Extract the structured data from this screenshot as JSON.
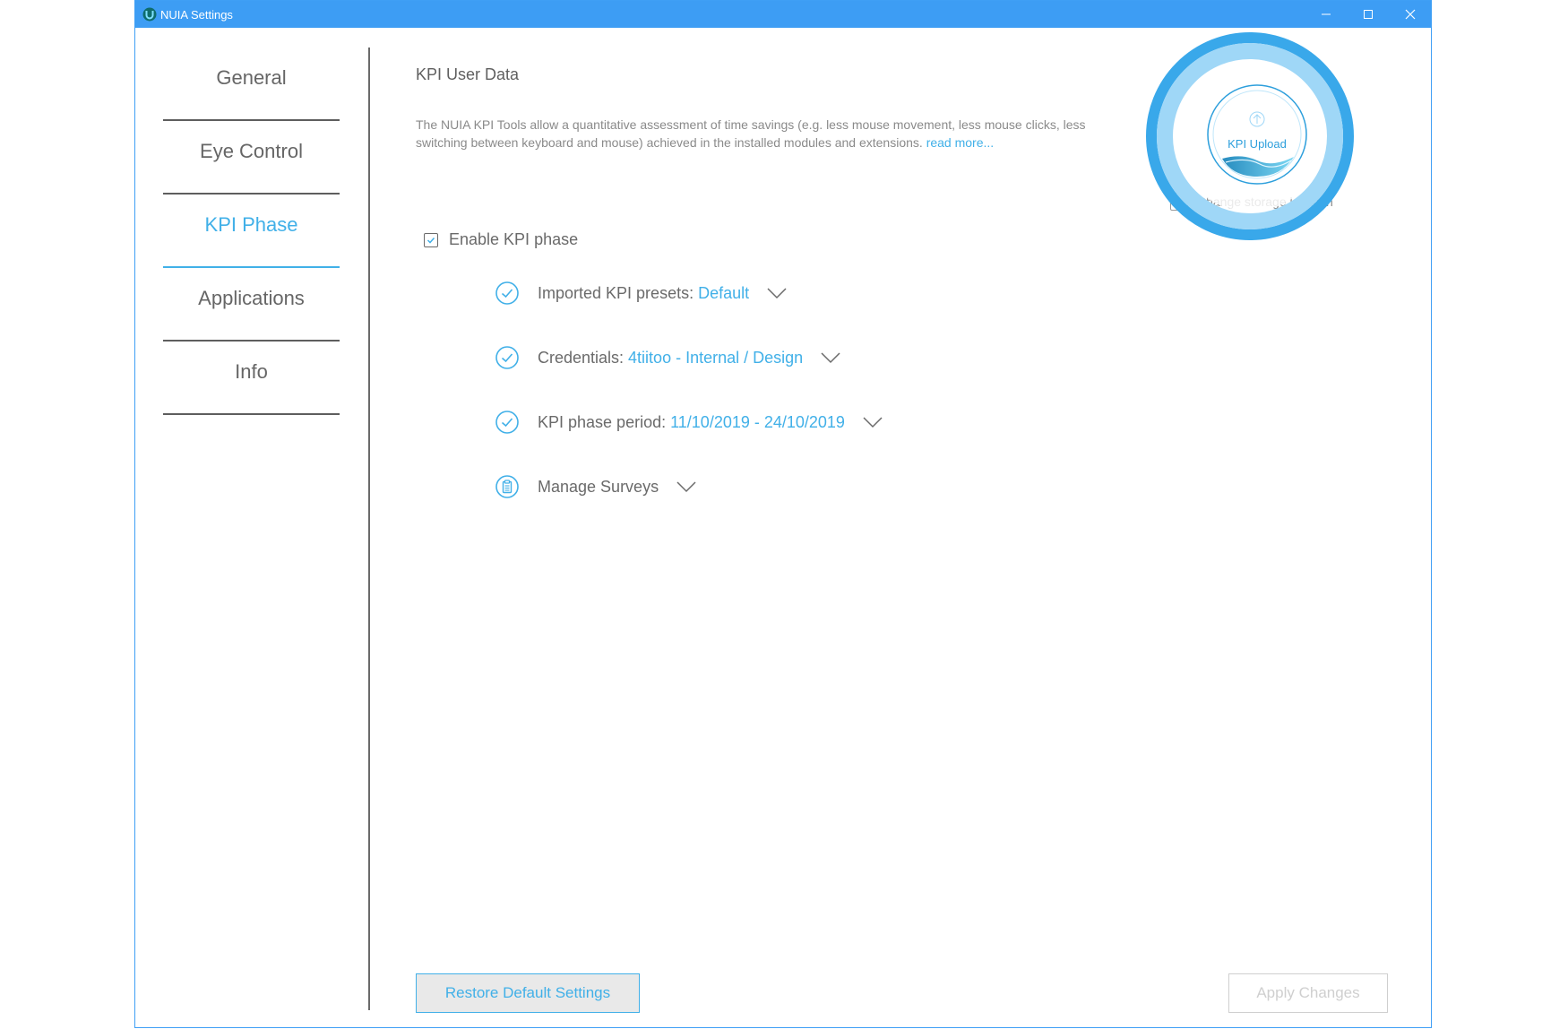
{
  "window": {
    "title": "NUIA Settings",
    "accent_color": "#3d9df4"
  },
  "sidebar": {
    "items": [
      {
        "label": "General"
      },
      {
        "label": "Eye Control"
      },
      {
        "label": "KPI Phase",
        "active": true
      },
      {
        "label": "Applications"
      },
      {
        "label": "Info"
      }
    ]
  },
  "main": {
    "title": "KPI User Data",
    "description": "The NUIA KPI Tools allow a quantitative assessment of time savings (e.g. less mouse movement, less mouse clicks, less switching between keyboard and mouse) achieved in the installed modules and extensions.",
    "read_more": "read more...",
    "enable_label": "Enable KPI phase",
    "enable_checked": true,
    "options": [
      {
        "label": "Imported KPI presets:",
        "value": "Default",
        "icon": "check-circle-icon"
      },
      {
        "label": "Credentials:",
        "value": "4tiitoo - Internal / Design",
        "icon": "check-circle-icon"
      },
      {
        "label": "KPI phase period:",
        "value": "11/10/2019 - 24/10/2019",
        "icon": "check-circle-icon"
      },
      {
        "label": "Manage Surveys",
        "value": "",
        "icon": "clipboard-icon"
      }
    ]
  },
  "kpi_upload": {
    "label": "KPI Upload",
    "storage_label": "Change storage location"
  },
  "buttons": {
    "restore": "Restore Default Settings",
    "apply": "Apply Changes"
  },
  "colors": {
    "link": "#41b0e8",
    "text": "#6a6a6a"
  }
}
